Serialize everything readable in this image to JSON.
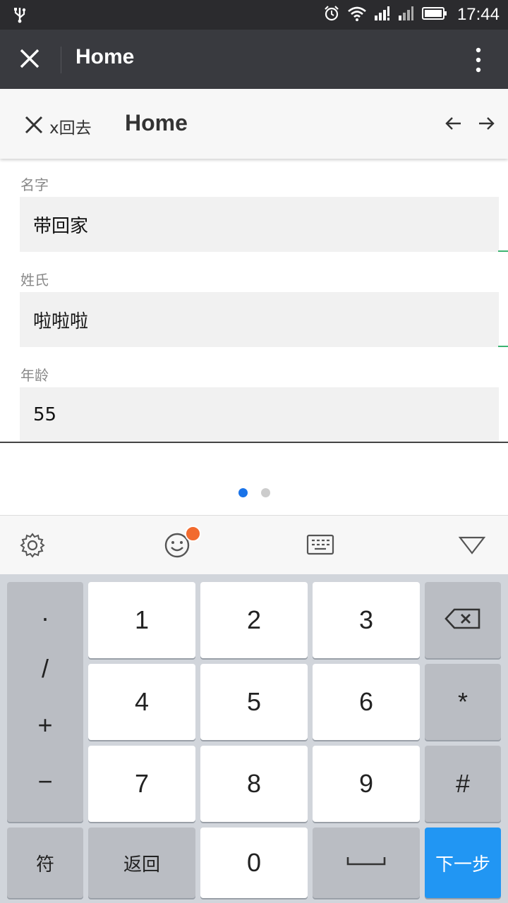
{
  "status_bar": {
    "time": "17:44"
  },
  "app_bar": {
    "title": "Home"
  },
  "nav_bar": {
    "back_label": "x回去",
    "title": "Home"
  },
  "form": {
    "fields": [
      {
        "label": "名字",
        "value": "带回家"
      },
      {
        "label": "姓氏",
        "value": "啦啦啦"
      },
      {
        "label": "年龄",
        "value": "55"
      }
    ]
  },
  "pager": {
    "pages": 2,
    "current": 1,
    "active_color": "#1a73e8",
    "inactive_color": "#cccccc"
  },
  "keyboard": {
    "toolbar": [
      "gear-icon",
      "emoji-icon",
      "keyboard-icon",
      "collapse-icon"
    ],
    "symbols": [
      "·",
      "/",
      "+",
      "−"
    ],
    "digits": [
      "1",
      "2",
      "3",
      "4",
      "5",
      "6",
      "7",
      "8",
      "9"
    ],
    "asterisk": "*",
    "hash": "#",
    "fu": "符",
    "back": "返回",
    "zero": "0",
    "next": "下一步",
    "accent": "#2196f3"
  }
}
